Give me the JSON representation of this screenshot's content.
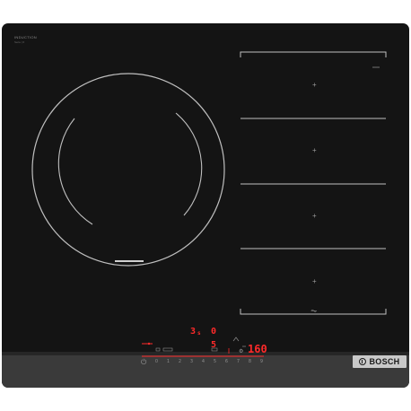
{
  "hob": {
    "brand_line1": "INDUCTION",
    "brand_line2": "Serie | 6",
    "badge_label": "BOSCH",
    "zone_plus_symbol": "+",
    "flex_zone_icon": "⏦"
  },
  "controls": {
    "top_left_digit": "3",
    "top_left_sub": "s",
    "top_mid_digit": "0",
    "mid_digit": "5",
    "power_symbol": "⏻",
    "timer_display": "160",
    "settings_icon": "⚙",
    "scale": [
      "0",
      "1",
      "2",
      "3",
      "4",
      "5",
      "6",
      "7",
      "8",
      "9"
    ]
  },
  "colors": {
    "glass": "#141414",
    "frame": "#3a3a3a",
    "zone_line": "#bfbfbf",
    "display_red": "#ff2a2a",
    "badge": "#c9c9c9"
  }
}
